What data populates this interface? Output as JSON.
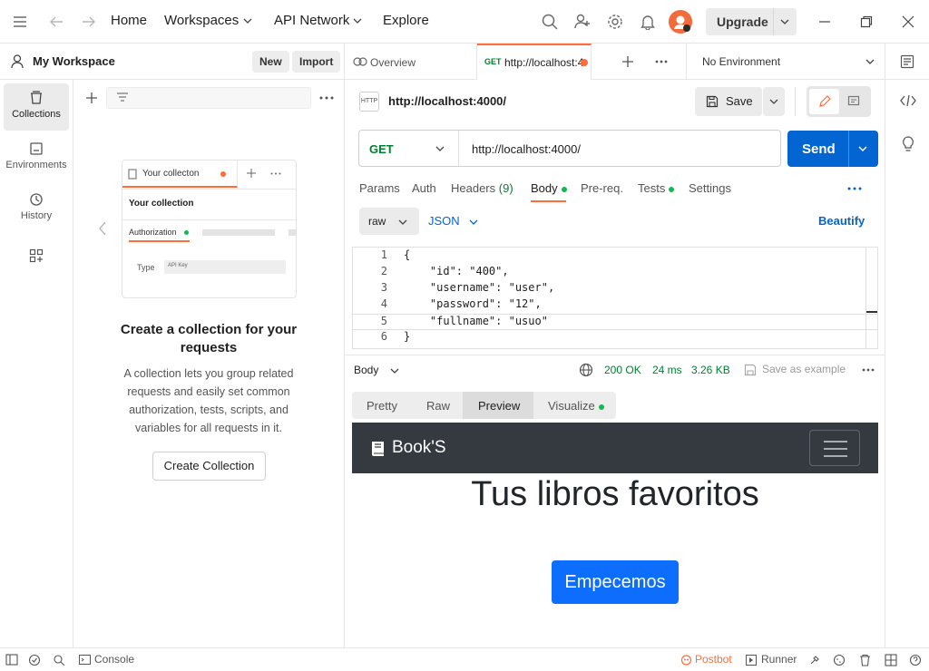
{
  "topbar": {
    "nav": [
      "Home",
      "Workspaces",
      "API Network",
      "Explore"
    ],
    "upgrade_label": "Upgrade",
    "avatar_color": "#f26b3a"
  },
  "workspace": {
    "title": "My Workspace",
    "new_label": "New",
    "import_label": "Import"
  },
  "rail": {
    "items": [
      {
        "label": "Collections",
        "icon": "collections-icon"
      },
      {
        "label": "Environments",
        "icon": "environments-icon"
      },
      {
        "label": "History",
        "icon": "history-icon"
      }
    ]
  },
  "empty_state": {
    "preview_tab": "Your collecton",
    "preview_title": "Your collection",
    "preview_auth": "Authorization",
    "preview_type_label": "Type",
    "preview_type_value": "API Key",
    "heading": "Create a collection for your requests",
    "description": "A collection lets you group related requests and easily set common authorization, tests, scripts, and variables for all requests in it.",
    "create_button": "Create Collection"
  },
  "tabs": {
    "overview": "Overview",
    "active_method": "GET",
    "active_url": "http://localhost:4(",
    "environment": "No Environment"
  },
  "request": {
    "title": "http://localhost:4000/",
    "save_label": "Save",
    "method": "GET",
    "url": "http://localhost:4000/",
    "send_label": "Send",
    "subtabs": [
      "Params",
      "Auth",
      "Headers",
      "Body",
      "Pre-req.",
      "Tests",
      "Settings"
    ],
    "headers_count": "(9)",
    "body_mode": "raw",
    "body_format": "JSON",
    "beautify": "Beautify",
    "body_lines": [
      {
        "n": "1",
        "text": "{"
      },
      {
        "n": "2",
        "text": "    \"id\": \"400\","
      },
      {
        "n": "3",
        "text": "    \"username\": \"user\","
      },
      {
        "n": "4",
        "text": "    \"password\": \"12\","
      },
      {
        "n": "5",
        "text": "    \"fullname\": \"usuo\""
      },
      {
        "n": "6",
        "text": "}"
      }
    ]
  },
  "response": {
    "label": "Body",
    "status": "200 OK",
    "time": "24 ms",
    "size": "3.26 KB",
    "save_example": "Save as example",
    "view_tabs": [
      "Pretty",
      "Raw",
      "Preview",
      "Visualize"
    ],
    "active_view": "Preview",
    "preview": {
      "brand": "Book'S",
      "headline": "Tus libros favoritos",
      "cta": "Empecemos"
    }
  },
  "statusbar": {
    "console": "Console",
    "postbot": "Postbot",
    "runner": "Runner"
  },
  "colors": {
    "accent_orange": "#ff6c37",
    "send_blue": "#0265d2",
    "success_green": "#0cbb52",
    "status_green": "#007f31",
    "navbar_dark": "#343a40",
    "bootstrap_blue": "#0d6efd"
  }
}
